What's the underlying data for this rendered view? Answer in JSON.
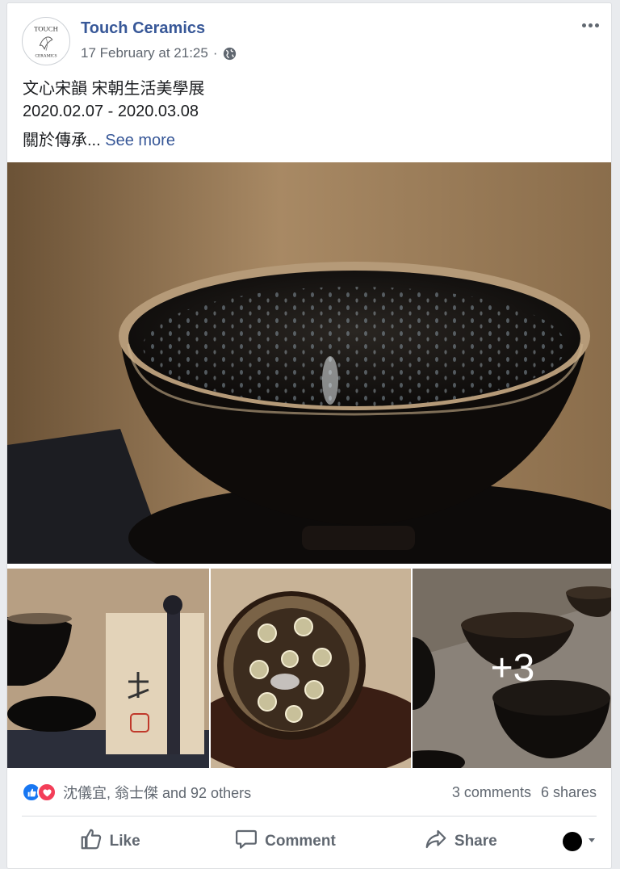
{
  "post": {
    "page_name": "Touch Ceramics",
    "avatar_text": {
      "top": "TOUCH",
      "bottom": "CERAMICS"
    },
    "timestamp": "17 February at 21:25",
    "separator": "·",
    "privacy_icon": "globe-icon",
    "more_icon": "more-options-icon",
    "text_line1": "文心宋韻 宋朝生活美學展",
    "text_line2": "2020.02.07 - 2020.03.08",
    "text_line3": "關於傳承...",
    "see_more": "See more"
  },
  "photos": {
    "more_count": "+3"
  },
  "engagement": {
    "reaction_names": "沈儀宜, 翁士傑 and 92 others",
    "comments": "3 comments",
    "shares": "6 shares",
    "reaction_icons": [
      "like-icon",
      "love-icon"
    ]
  },
  "actions": {
    "like": "Like",
    "comment": "Comment",
    "share": "Share"
  },
  "colors": {
    "link": "#385898",
    "like_blue": "#1877f2",
    "love_red": "#f33e58"
  }
}
